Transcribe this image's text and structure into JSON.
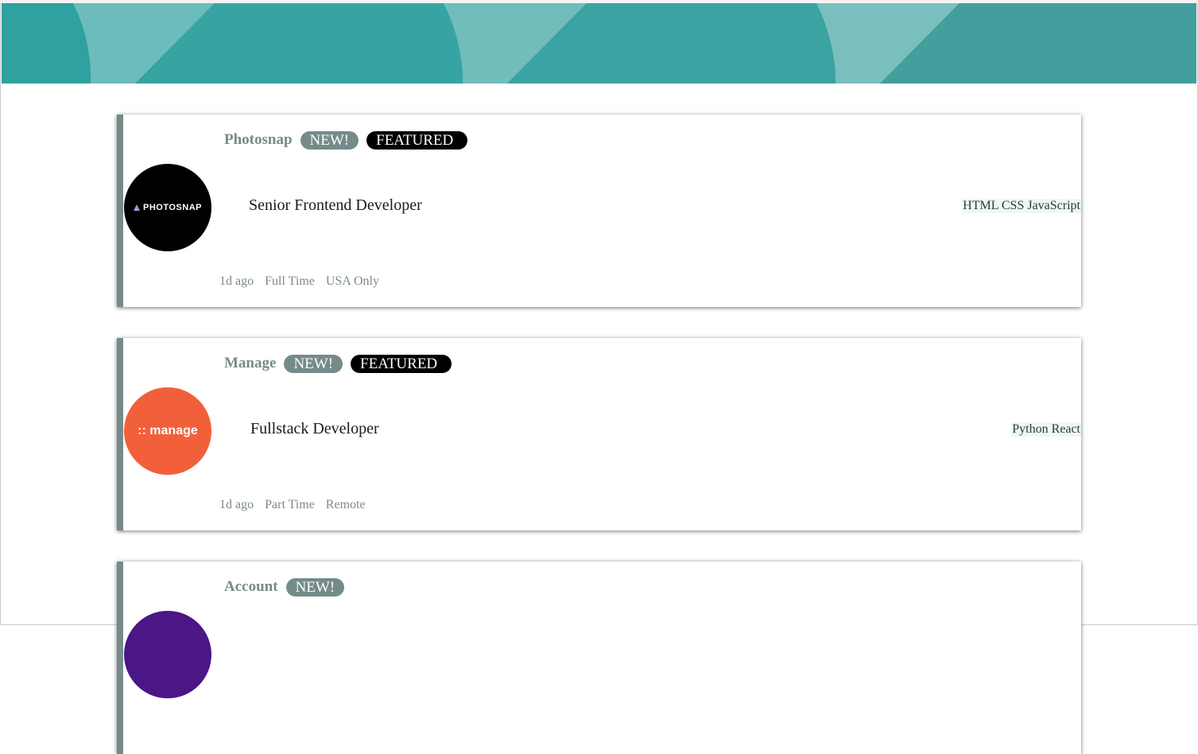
{
  "colors": {
    "banner": "#3aa4a3",
    "accent": "#758b8a",
    "featured": "#000000",
    "tool_bg": "#eff6f6"
  },
  "jobs": [
    {
      "company": "Photosnap",
      "logo_text": "PHOTOSNAP",
      "logo_color": "#000000",
      "new_label": "NEW!",
      "featured_label": "FEATURED",
      "position": "Senior Frontend Developer",
      "tools": "HTML CSS JavaScript",
      "posted": "1d ago",
      "contract": "Full Time",
      "location": "USA Only"
    },
    {
      "company": "Manage",
      "logo_text": ":: manage",
      "logo_color": "#f1603b",
      "new_label": "NEW!",
      "featured_label": "FEATURED",
      "position": "Fullstack Developer",
      "tools": "Python React",
      "posted": "1d ago",
      "contract": "Part Time",
      "location": "Remote"
    },
    {
      "company": "Account",
      "logo_color": "#4b1685",
      "new_label": "NEW!"
    }
  ]
}
